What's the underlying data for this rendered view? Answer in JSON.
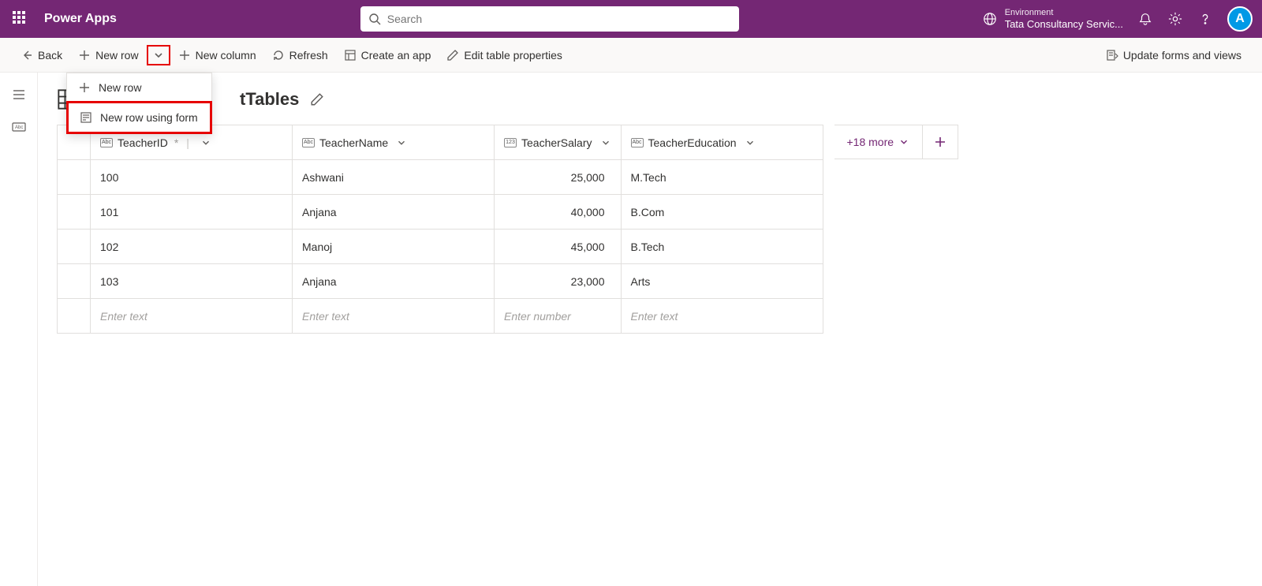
{
  "header": {
    "app_title": "Power Apps",
    "search_placeholder": "Search",
    "environment_label": "Environment",
    "environment_name": "Tata Consultancy Servic...",
    "avatar_initial": "A"
  },
  "commands": {
    "back": "Back",
    "new_row": "New row",
    "new_column": "New column",
    "refresh": "Refresh",
    "create_app": "Create an app",
    "edit_table": "Edit table properties",
    "update_forms": "Update forms and views"
  },
  "dropdown": {
    "new_row": "New row",
    "new_row_form": "New row using form"
  },
  "page": {
    "title_suffix": "tTables",
    "more_columns": "+18 more"
  },
  "columns": {
    "teacher_id": "TeacherID",
    "teacher_name": "TeacherName",
    "teacher_salary": "TeacherSalary",
    "teacher_education": "TeacherEducation"
  },
  "rows": [
    {
      "id": "100",
      "name": "Ashwani",
      "salary": "25,000",
      "education": "M.Tech"
    },
    {
      "id": "101",
      "name": "Anjana",
      "salary": "40,000",
      "education": "B.Com"
    },
    {
      "id": "102",
      "name": "Manoj",
      "salary": "45,000",
      "education": "B.Tech"
    },
    {
      "id": "103",
      "name": "Anjana",
      "salary": "23,000",
      "education": "Arts"
    }
  ],
  "placeholders": {
    "text": "Enter text",
    "number": "Enter number"
  }
}
